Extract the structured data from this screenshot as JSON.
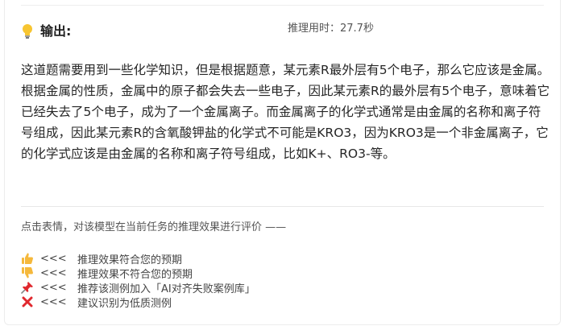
{
  "header": {
    "title": "输出:",
    "elapsed": "推理用时：27.7秒"
  },
  "answer": {
    "text": "这道题需要用到一些化学知识，但是根据题意，某元素R最外层有5个电子，那么它应该是金属。根据金属的性质，金属中的原子都会失去一些电子，因此某元素R的最外层有5个电子，意味着它已经失去了5个电子，成为了一个金属离子。而金属离子的化学式通常是由金属的名称和离子符号组成，因此某元素R的含氧酸钾盐的化学式不可能是KRO3，因为KRO3是一个非金属离子，它的化学式应该是由金属的名称和离子符号组成，比如K+、RO3-等。"
  },
  "feedback": {
    "hint": "点击表情，对该模型在当前任务的推理效果进行评价 ——",
    "options": [
      {
        "icon": "thumbs-up-icon",
        "arrow": "<<<",
        "label": "推理效果符合您的预期"
      },
      {
        "icon": "thumbs-down-icon",
        "arrow": "<<<",
        "label": "推理效果不符合您的预期"
      },
      {
        "icon": "pushpin-icon",
        "arrow": "<<<",
        "label": "推荐该测例加入「AI对齐失败案例库」"
      },
      {
        "icon": "cross-mark-icon",
        "arrow": "<<<",
        "label": "建议识别为低质测例"
      }
    ]
  },
  "colors": {
    "bulb": "#f7c531",
    "thumb": "#f5b83b",
    "pin": "#e0282e",
    "cross": "#e0282e"
  }
}
